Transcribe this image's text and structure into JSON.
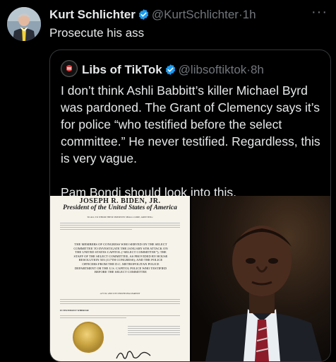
{
  "post": {
    "author_name": "Kurt Schlichter",
    "handle": "@KurtSchlichter",
    "separator": "·",
    "time": "1h",
    "text": "Prosecute his ass",
    "more_icon": "ellipsis-icon"
  },
  "quoted": {
    "author_name": "Libs of TikTok",
    "handle": "@libsoftiktok",
    "separator": "·",
    "time": "8h",
    "text": "I don’t think Ashli Babbitt’s killer Michael Byrd was pardoned. The Grant of Clemency says it’s for police “who testified before the select committee.” He never testified. Regardless, this is very vague.\n\nPam Bondi should look into this."
  },
  "document": {
    "heading": "JOSEPH R. BIDEN, JR.",
    "subheading": "President of the United States of America",
    "greeting": "TO ALL TO WHOM THESE PRESENTS SHALL COME, GREETING:",
    "body": "THE MEMBERS OF CONGRESS WHO SERVED ON THE SELECT COMMITTEE TO INVESTIGATE THE JANUARY 6TH ATTACK ON THE UNITED STATES CAPITOL (“SELECT COMMITTEE”); THE STAFF OF THE SELECT COMMITTEE, AS PROVIDED BY HOUSE RESOLUTION 503 (117TH CONGRESS); AND THE POLICE OFFICERS FROM THE D.C. METROPOLITAN POLICE DEPARTMENT OR THE U.S. CAPITOL POLICE WHO TESTIFIED BEFORE THE SELECT COMMITTEE",
    "pardon_label": "A FULL AND UNCONDITIONAL PARDON",
    "witness_label": "IN TESTIMONY WHEREOF"
  },
  "colors": {
    "background": "#000000",
    "text": "#e7e9ea",
    "muted": "#71767b",
    "verified": "#1d9bf0",
    "border": "#333639"
  }
}
